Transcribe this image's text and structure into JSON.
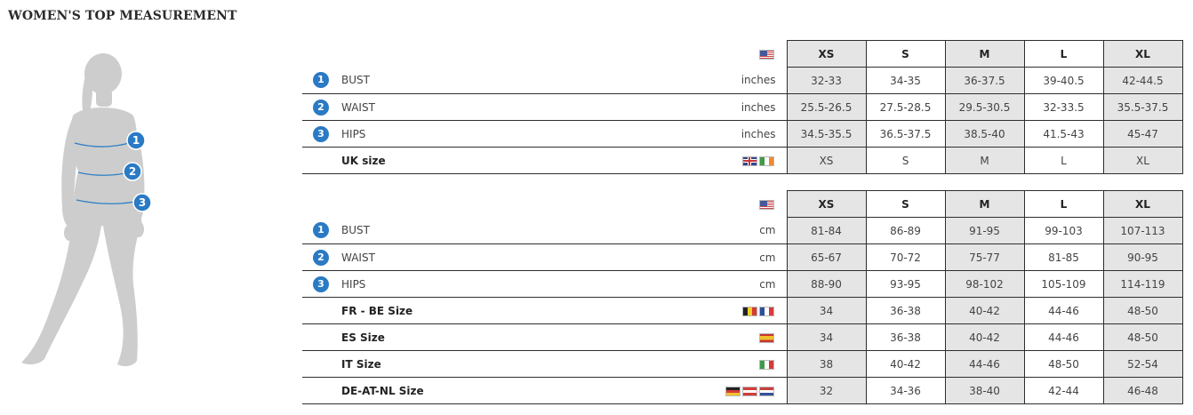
{
  "page": {
    "title": "WOMEN'S TOP MEASUREMENT"
  },
  "figure": {
    "markers": [
      "1",
      "2",
      "3"
    ]
  },
  "sizes": [
    "XS",
    "S",
    "M",
    "L",
    "XL"
  ],
  "inches_table": {
    "header_flag": "flag-us",
    "rows": [
      {
        "num": "1",
        "label": "BUST",
        "unit": "inches",
        "values": [
          "32-33",
          "34-35",
          "36-37.5",
          "39-40.5",
          "42-44.5"
        ]
      },
      {
        "num": "2",
        "label": "WAIST",
        "unit": "inches",
        "values": [
          "25.5-26.5",
          "27.5-28.5",
          "29.5-30.5",
          "32-33.5",
          "35.5-37.5"
        ]
      },
      {
        "num": "3",
        "label": "HIPS",
        "unit": "inches",
        "values": [
          "34.5-35.5",
          "36.5-37.5",
          "38.5-40",
          "41.5-43",
          "45-47"
        ]
      }
    ],
    "conversions": [
      {
        "label": "UK size",
        "flags": [
          "flag-uk",
          "flag-ie"
        ],
        "values": [
          "XS",
          "S",
          "M",
          "L",
          "XL"
        ]
      }
    ]
  },
  "cm_table": {
    "header_flag": "flag-us",
    "rows": [
      {
        "num": "1",
        "label": "BUST",
        "unit": "cm",
        "values": [
          "81-84",
          "86-89",
          "91-95",
          "99-103",
          "107-113"
        ]
      },
      {
        "num": "2",
        "label": "WAIST",
        "unit": "cm",
        "values": [
          "65-67",
          "70-72",
          "75-77",
          "81-85",
          "90-95"
        ]
      },
      {
        "num": "3",
        "label": "HIPS",
        "unit": "cm",
        "values": [
          "88-90",
          "93-95",
          "98-102",
          "105-109",
          "114-119"
        ]
      }
    ],
    "conversions": [
      {
        "label": "FR - BE Size",
        "flags": [
          "flag-be",
          "flag-fr"
        ],
        "values": [
          "34",
          "36-38",
          "40-42",
          "44-46",
          "48-50"
        ]
      },
      {
        "label": "ES Size",
        "flags": [
          "flag-es"
        ],
        "values": [
          "34",
          "36-38",
          "40-42",
          "44-46",
          "48-50"
        ]
      },
      {
        "label": "IT Size",
        "flags": [
          "flag-it"
        ],
        "values": [
          "38",
          "40-42",
          "44-46",
          "48-50",
          "52-54"
        ]
      },
      {
        "label": "DE-AT-NL Size",
        "flags": [
          "flag-de",
          "flag-at",
          "flag-nl"
        ],
        "values": [
          "32",
          "34-36",
          "38-40",
          "42-44",
          "46-48"
        ]
      }
    ]
  }
}
